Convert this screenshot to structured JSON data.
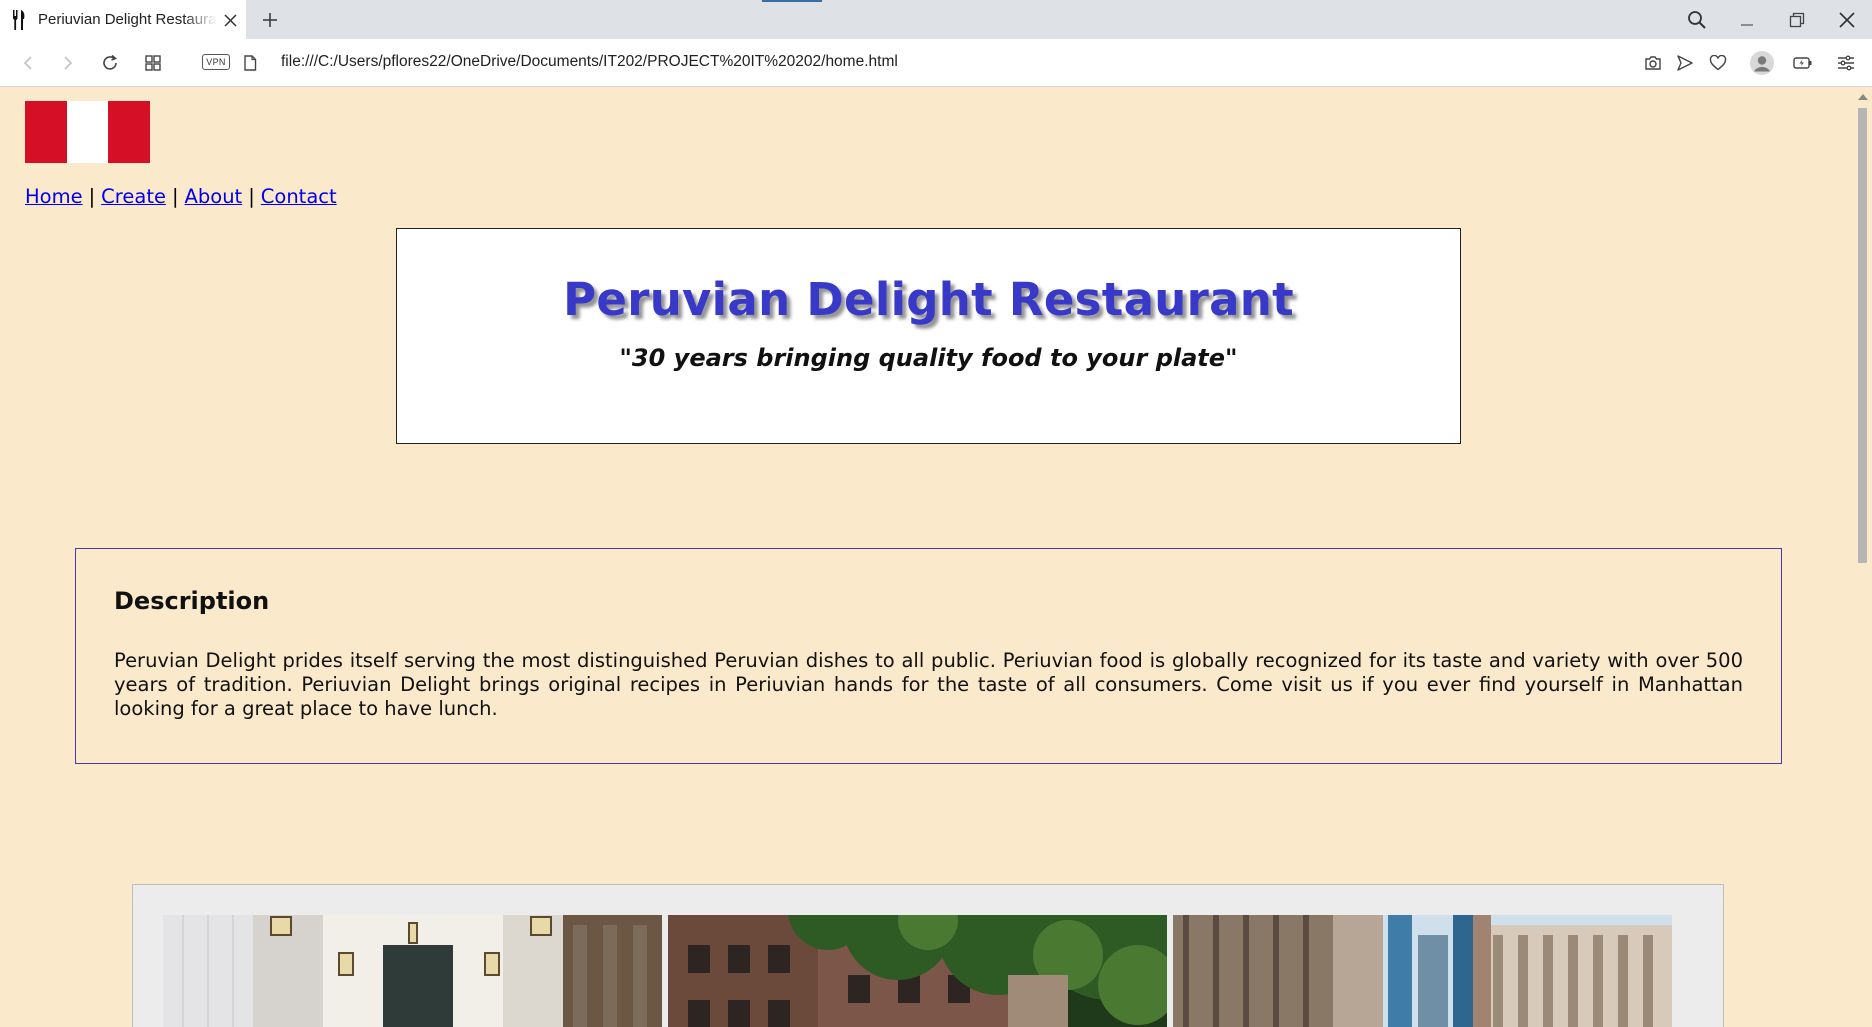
{
  "browser": {
    "tab_title": "Periuvian Delight Restaurant",
    "url": "file:///C:/Users/pflores22/OneDrive/Documents/IT202/PROJECT%20IT%20202/home.html",
    "vpn_label": "VPN"
  },
  "page": {
    "background_color": "#fbe9cb",
    "nav": {
      "items": [
        {
          "label": "Home"
        },
        {
          "label": "Create"
        },
        {
          "label": "About"
        },
        {
          "label": "Contact"
        }
      ],
      "separator": "|"
    },
    "header": {
      "title": "Peruvian Delight Restaurant",
      "tagline": "\"30 years bringing quality food to your plate\""
    },
    "description": {
      "heading": "Description",
      "body": "Peruvian Delight prides itself serving the most distinguished Peruvian dishes to all public. Periuvian food is globally recognized for its taste and variety with over 500 years of tradition. Periuvian Delight brings original recipes in Periuvian hands for the taste of all consumers. Come visit us if you ever find yourself in Manhattan looking for a great place to have lunch."
    },
    "gallery": {
      "photos": [
        {
          "subject": "restaurant-interior-photo"
        },
        {
          "subject": "brick-building-trees-photo"
        },
        {
          "subject": "manhattan-street-photo"
        }
      ]
    }
  },
  "colors": {
    "title_blue": "#3838c9",
    "link_blue": "#0000ee",
    "flag_red": "#d50f25",
    "description_border": "#4b3ba8"
  }
}
